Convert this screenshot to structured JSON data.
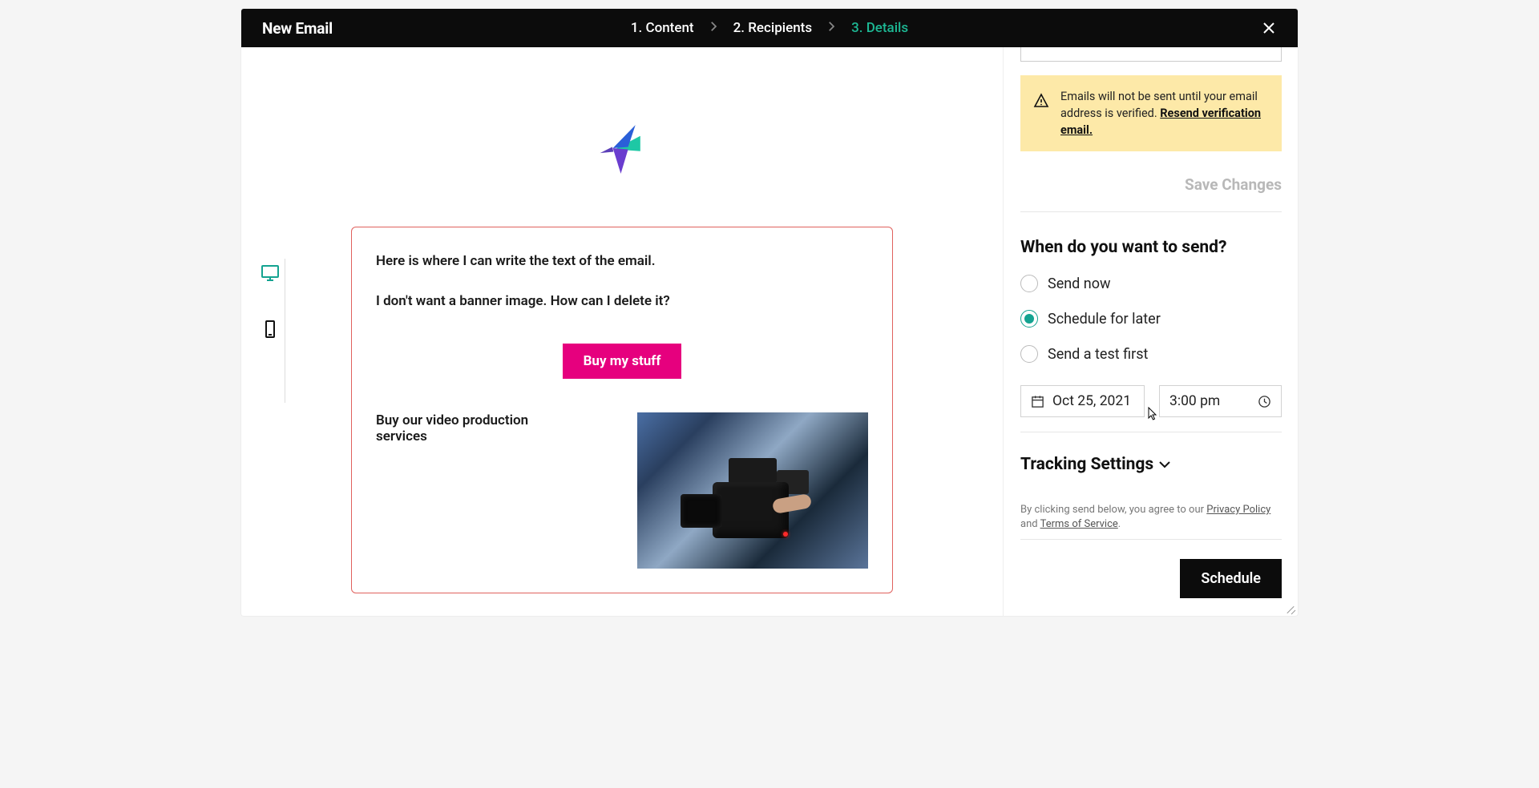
{
  "header": {
    "title": "New Email",
    "steps": [
      {
        "label": "1. Content",
        "active": false
      },
      {
        "label": "2. Recipients",
        "active": false
      },
      {
        "label": "3. Details",
        "active": true
      }
    ]
  },
  "preview": {
    "devices": {
      "desktop_active": true
    },
    "body_line1": "Here is where I can write the text of the email.",
    "body_line2": "I don't want a banner image. How can I delete it?",
    "cta_label": "Buy my stuff",
    "row2_text": "Buy our video production services"
  },
  "sidebar": {
    "alert": {
      "text": "Emails will not be sent until your email address is verified. ",
      "link_text": "Resend verification email."
    },
    "save_label": "Save Changes",
    "when_title": "When do you want to send?",
    "options": {
      "send_now": "Send now",
      "schedule_later": "Schedule for later",
      "send_test": "Send a test first"
    },
    "date_value": "Oct 25, 2021",
    "time_value": "3:00 pm",
    "tracking_label": "Tracking Settings",
    "legal": {
      "prefix": "By clicking send below, you agree to our ",
      "privacy": "Privacy Policy",
      "and": " and ",
      "tos": "Terms of Service",
      "suffix": "."
    },
    "schedule_btn": "Schedule"
  }
}
